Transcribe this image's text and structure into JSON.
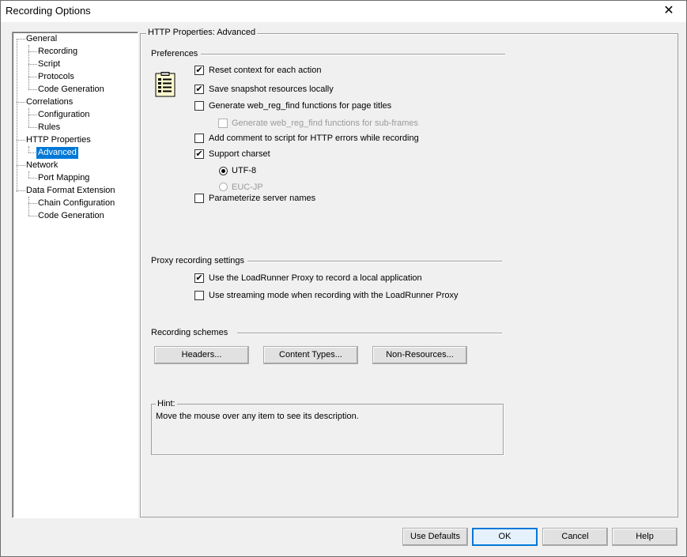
{
  "window": {
    "title": "Recording Options",
    "close_glyph": "✕"
  },
  "tree": {
    "items": [
      {
        "label": "General"
      },
      {
        "label": "Recording"
      },
      {
        "label": "Script"
      },
      {
        "label": "Protocols"
      },
      {
        "label": "Code Generation"
      },
      {
        "label": "Correlations"
      },
      {
        "label": "Configuration"
      },
      {
        "label": "Rules"
      },
      {
        "label": "HTTP Properties"
      },
      {
        "label": "Advanced",
        "selected": true
      },
      {
        "label": "Network"
      },
      {
        "label": "Port Mapping"
      },
      {
        "label": "Data Format Extension"
      },
      {
        "label": "Chain Configuration"
      },
      {
        "label": "Code Generation"
      }
    ]
  },
  "panel": {
    "title": "HTTP Properties: Advanced",
    "preferences": {
      "label": "Preferences",
      "icon": "document-list-icon",
      "options": [
        {
          "label": "Reset context for each action",
          "checked": true,
          "enabled": true
        },
        {
          "label": "Save snapshot resources locally",
          "checked": true,
          "enabled": true
        },
        {
          "label": "Generate web_reg_find functions for page titles",
          "checked": false,
          "enabled": true
        },
        {
          "label": "Generate web_reg_find functions for sub-frames",
          "checked": false,
          "enabled": false
        },
        {
          "label": "Add comment to script for HTTP errors while recording",
          "checked": false,
          "enabled": true
        },
        {
          "label": "Support charset",
          "checked": true,
          "enabled": true
        },
        {
          "label": "Parameterize server names",
          "checked": false,
          "enabled": true
        }
      ],
      "charset_options": [
        {
          "label": "UTF-8",
          "selected": true,
          "enabled": true
        },
        {
          "label": "EUC-JP",
          "selected": false,
          "enabled": false
        }
      ]
    },
    "proxy": {
      "label": "Proxy recording settings",
      "options": [
        {
          "label": "Use the LoadRunner Proxy to record a local application",
          "checked": true
        },
        {
          "label": "Use streaming mode when recording with the LoadRunner Proxy",
          "checked": false
        }
      ]
    },
    "schemes": {
      "label": "Recording schemes",
      "buttons": [
        "Headers...",
        "Content Types...",
        "Non-Resources..."
      ]
    },
    "hint": {
      "label": "Hint:",
      "text": "Move the mouse over any item to see its description."
    }
  },
  "footer": {
    "use_defaults": "Use Defaults",
    "ok": "OK",
    "cancel": "Cancel",
    "help": "Help"
  },
  "check_glyph": "✔"
}
